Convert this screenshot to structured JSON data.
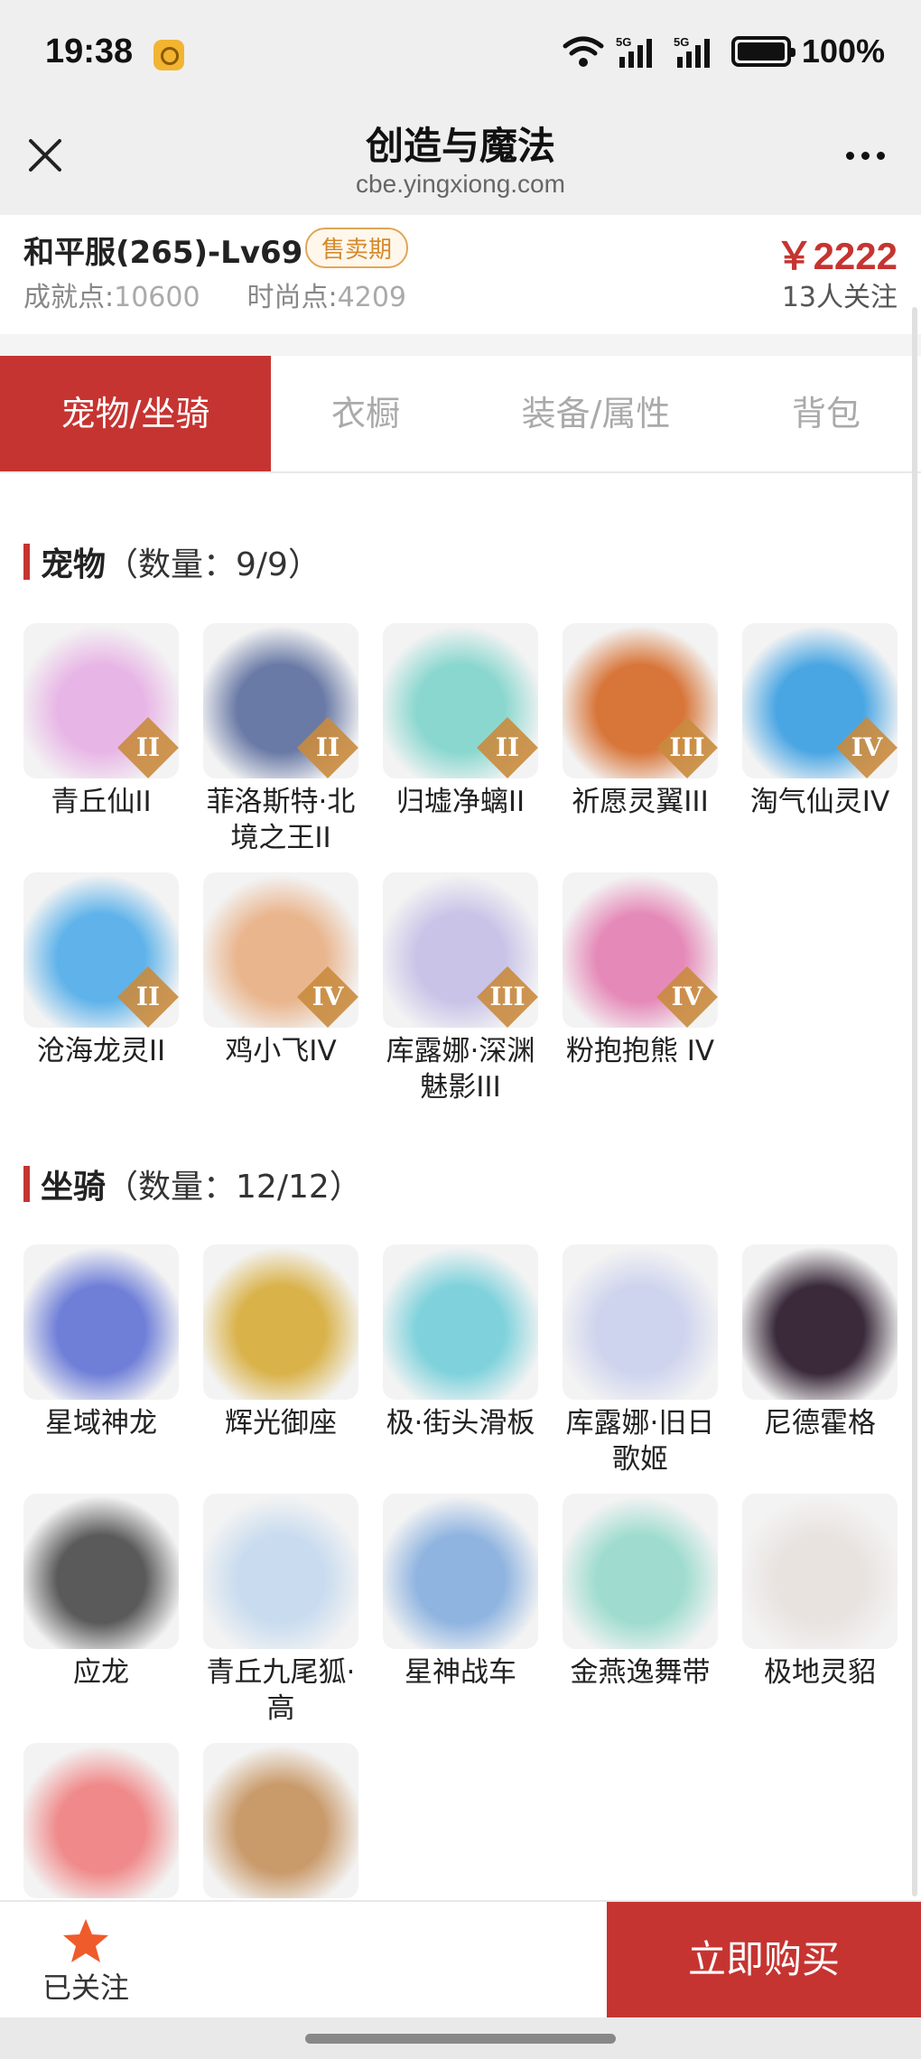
{
  "status_bar": {
    "time": "19:38",
    "network": "5G",
    "battery": "100%"
  },
  "nav": {
    "title": "创造与魔法",
    "subtitle": "cbe.yingxiong.com"
  },
  "account": {
    "title": "和平服(265)-Lv69",
    "badge": "售卖期",
    "price": "￥2222",
    "followers": "13人关注",
    "achievement_label": "成就点:",
    "achievement_value": "10600",
    "fashion_label": "时尚点:",
    "fashion_value": "4209"
  },
  "tabs": [
    {
      "label": "宠物/坐骑",
      "active": true
    },
    {
      "label": "衣橱",
      "active": false
    },
    {
      "label": "装备/属性",
      "active": false
    },
    {
      "label": "背包",
      "active": false
    }
  ],
  "pets": {
    "name": "宠物",
    "count": "（数量：9/9）",
    "items": [
      {
        "name": "青丘仙II",
        "tier": "II",
        "color": "#e8b6e6"
      },
      {
        "name": "菲洛斯特·北境之王II",
        "tier": "II",
        "color": "#6a7aa6"
      },
      {
        "name": "归墟净螭II",
        "tier": "II",
        "color": "#8ad7cf"
      },
      {
        "name": "祈愿灵翼III",
        "tier": "III",
        "color": "#d8763a"
      },
      {
        "name": "淘气仙灵IV",
        "tier": "IV",
        "color": "#4aa6e3"
      },
      {
        "name": "沧海龙灵II",
        "tier": "II",
        "color": "#5fb3ea"
      },
      {
        "name": "鸡小飞IV",
        "tier": "IV",
        "color": "#e9b58d"
      },
      {
        "name": "库露娜·深渊魅影III",
        "tier": "III",
        "color": "#c9c3e8"
      },
      {
        "name": "粉抱抱熊 IV",
        "tier": "IV",
        "color": "#e58ab8"
      }
    ]
  },
  "mounts": {
    "name": "坐骑",
    "count": "（数量：12/12）",
    "items": [
      {
        "name": "星域神龙",
        "color": "#6f7fd8"
      },
      {
        "name": "辉光御座",
        "color": "#d9b24a"
      },
      {
        "name": "极·街头滑板",
        "color": "#7fd2dc"
      },
      {
        "name": "库露娜·旧日歌姬",
        "color": "#cfd4ee"
      },
      {
        "name": "尼德霍格",
        "color": "#3a2a3a"
      },
      {
        "name": "应龙",
        "color": "#5a5a5a"
      },
      {
        "name": "青丘九尾狐·高",
        "color": "#c9dcef"
      },
      {
        "name": "星神战车",
        "color": "#8fb4e0"
      },
      {
        "name": "金燕逸舞带",
        "color": "#9fdccf"
      },
      {
        "name": "极地灵貂",
        "color": "#e9e3e0"
      },
      {
        "name": "",
        "color": "#f08a8a"
      },
      {
        "name": "",
        "color": "#c99a6a"
      }
    ]
  },
  "bottom": {
    "follow_label": "已关注",
    "buy_label": "立即购买"
  },
  "colors": {
    "accent": "#c63431",
    "badge_text": "#d58a2c",
    "tier_badge": "#c98b3e"
  },
  "icons": [
    "close-icon",
    "more-icon",
    "wifi-icon",
    "signal-icon",
    "battery-icon",
    "star-icon"
  ]
}
